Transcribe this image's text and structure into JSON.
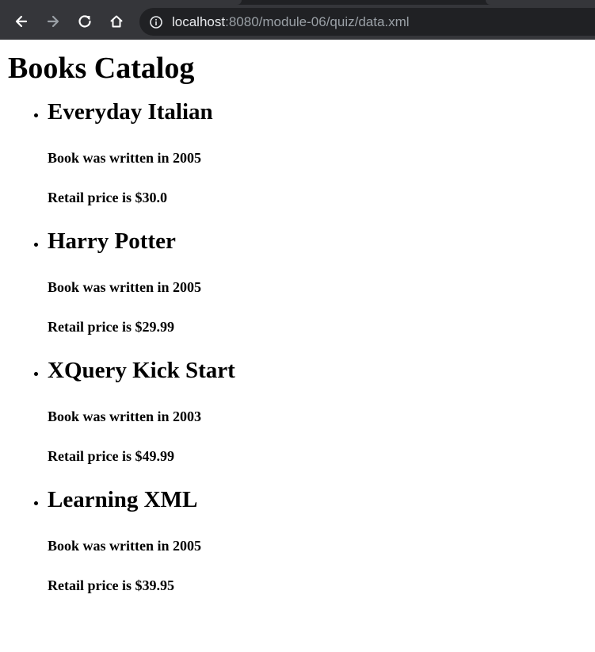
{
  "browser": {
    "url_host": "localhost",
    "url_rest": ":8080/module-06/quiz/data.xml",
    "icons": {
      "back": "arrow-left-icon",
      "forward": "arrow-right-icon",
      "reload": "reload-icon",
      "home": "home-icon",
      "info": "info-icon"
    }
  },
  "page": {
    "title": "Books Catalog",
    "books": [
      {
        "title": "Everyday Italian",
        "year_text": "Book was written in 2005",
        "price_text": "Retail price is $30.0"
      },
      {
        "title": "Harry Potter",
        "year_text": "Book was written in 2005",
        "price_text": "Retail price is $29.99"
      },
      {
        "title": "XQuery Kick Start",
        "year_text": "Book was written in 2003",
        "price_text": "Retail price is $49.99"
      },
      {
        "title": "Learning XML",
        "year_text": "Book was written in 2005",
        "price_text": "Retail price is $39.95"
      }
    ]
  }
}
